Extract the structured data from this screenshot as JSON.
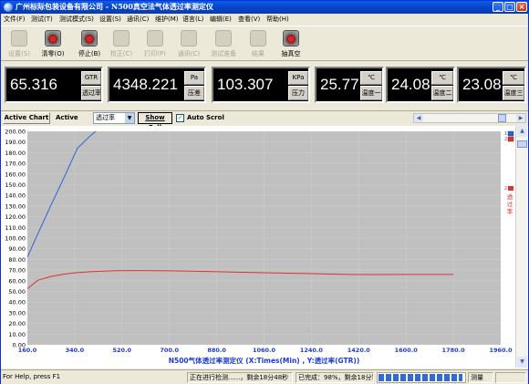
{
  "window": {
    "title": "广州标际包装设备有限公司 - N500真空法气体透过率测定仪",
    "minimize": "_",
    "maximize": "□",
    "close": "×"
  },
  "menu": [
    "文件(F)",
    "测试(T)",
    "测试模式(S)",
    "设置(S)",
    "通讯(C)",
    "维护(M)",
    "语言(L)",
    "编辑(E)",
    "查看(V)",
    "帮助(H)"
  ],
  "toolbar": [
    {
      "label": "设置(S)",
      "enabled": false,
      "icon": "settings-icon"
    },
    {
      "label": "清零(O)",
      "enabled": true,
      "icon": "zero-icon"
    },
    {
      "label": "停止(B)",
      "enabled": true,
      "icon": "stop-icon"
    },
    {
      "label": "校正(C)",
      "enabled": false,
      "icon": "calibrate-icon"
    },
    {
      "label": "打印(P)",
      "enabled": false,
      "icon": "print-icon"
    },
    {
      "label": "通讯(C)",
      "enabled": false,
      "icon": "communication-icon"
    },
    {
      "label": "测试准备",
      "enabled": false,
      "icon": "prepare-icon"
    },
    {
      "label": "结果",
      "enabled": false,
      "icon": "result-icon"
    },
    {
      "label": "抽真空",
      "enabled": true,
      "icon": "vacuum-icon"
    }
  ],
  "readouts": [
    {
      "value": "65.316",
      "unit": "GTR",
      "label": "透过率"
    },
    {
      "value": "4348.221",
      "unit": "Pa",
      "label": "压差"
    },
    {
      "value": "103.307",
      "unit": "KPa",
      "label": "压力"
    },
    {
      "value": "25.77",
      "unit": "℃",
      "label": "温度一"
    },
    {
      "value": "24.08",
      "unit": "℃",
      "label": "温度二"
    },
    {
      "value": "23.08",
      "unit": "℃",
      "label": "温度三"
    }
  ],
  "chart_toolbar": {
    "active_chart_button": "Active Chart",
    "active_label": "Active",
    "series_select": "透过率",
    "show_full_button": "Show Full",
    "auto_scroll_checked": true,
    "auto_scroll_label": "Auto Scrol"
  },
  "chart_data": {
    "type": "line",
    "title": "N500气体透过率测定仪 (X:Times(Min) , Y:透过率(GTR))",
    "xlim": [
      160.0,
      1960.0
    ],
    "ylim": [
      0.0,
      200.0
    ],
    "x_ticks": [
      "160.0",
      "340.0",
      "520.0",
      "700.0",
      "880.0",
      "1060.0",
      "1240.0",
      "1420.0",
      "1600.0",
      "1780.0",
      "1960.0"
    ],
    "y_ticks": [
      "0.00",
      "10.00",
      "20.00",
      "30.00",
      "40.00",
      "50.00",
      "60.00",
      "70.00",
      "80.00",
      "90.00",
      "100.00",
      "110.00",
      "120.00",
      "130.00",
      "140.00",
      "150.00",
      "160.00",
      "170.00",
      "180.00",
      "190.00",
      "200.00"
    ],
    "grid": true,
    "legend_position": "right",
    "series": [
      {
        "color": "#2c62d6",
        "x": [
          160,
          200,
          250,
          300,
          350,
          400,
          420
        ],
        "y": [
          82,
          104,
          131,
          157,
          184,
          196,
          200
        ]
      },
      {
        "name": "透过率",
        "color": "#e03030",
        "x": [
          160,
          200,
          250,
          300,
          350,
          400,
          450,
          500,
          550,
          600,
          700,
          800,
          900,
          1000,
          1100,
          1200,
          1300,
          1400,
          1500,
          1600,
          1700,
          1780
        ],
        "y": [
          52.5,
          60.5,
          64.0,
          66.2,
          67.6,
          68.5,
          69.0,
          69.4,
          69.6,
          69.6,
          69.3,
          68.9,
          68.4,
          67.9,
          67.3,
          66.8,
          66.3,
          65.8,
          65.8,
          65.9,
          65.9,
          65.9
        ]
      }
    ],
    "legend_markers": [
      "1",
      "2"
    ]
  },
  "statusbar": {
    "help": "For Help, press F1",
    "progress_text": "正在进行检测......，剩余18分48秒",
    "done_text": "已完成：98%，剩余18分钟",
    "progress": 0.98,
    "mode": "测量"
  }
}
